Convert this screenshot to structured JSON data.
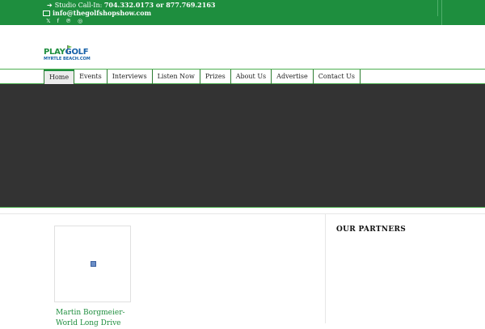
{
  "topbar": {
    "studio_label": "Studio Call-In:",
    "phones": "704.332.0173 or 877.769.2163",
    "email": "info@thegolfshopshow.com",
    "social_icons": [
      "x-icon",
      "facebook-icon",
      "pinterest-icon",
      "instagram-icon"
    ]
  },
  "logo": {
    "line1a": "PLAY",
    "line1b": "GOLF",
    "line2": "MYRTLE BEACH.COM"
  },
  "nav": {
    "items": [
      "Home",
      "Events",
      "Interviews",
      "Listen Now",
      "Prizes",
      "About Us",
      "Advertise",
      "Contact Us"
    ],
    "active": "Home"
  },
  "sidebar": {
    "heading": "OUR PARTNERS"
  },
  "post": {
    "title": "Martin Borgmeier-World Long Drive"
  },
  "colors": {
    "brand_green": "#1e8e3e",
    "hero_bg": "#333333",
    "logo_blue": "#1560a8"
  }
}
